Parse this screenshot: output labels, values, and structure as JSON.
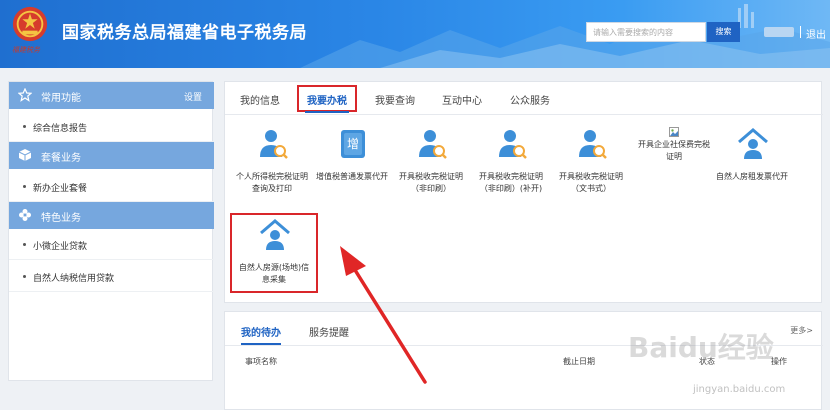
{
  "header": {
    "title": "国家税务总局福建省电子税务局",
    "emblem_script": "福建税务",
    "search_placeholder": "请输入需要搜索的内容",
    "search_button": "搜索",
    "logout": "退出"
  },
  "sidebar": {
    "sections": [
      {
        "title": "常用功能",
        "action": "设置",
        "icon": "star-icon",
        "items": [
          "综合信息报告"
        ]
      },
      {
        "title": "套餐业务",
        "icon": "cube-icon",
        "items": [
          "新办企业套餐"
        ]
      },
      {
        "title": "特色业务",
        "icon": "flower-icon",
        "items": [
          "小微企业贷款",
          "自然人纳税信用贷款"
        ]
      }
    ]
  },
  "main": {
    "tabs": [
      "我的信息",
      "我要办税",
      "我要查询",
      "互动中心",
      "公众服务"
    ],
    "active_tab": "我要办税",
    "services": [
      {
        "label": "个人所得税完税证明查询及打印",
        "icon": "person-search-icon"
      },
      {
        "label": "增值税普通发票代开",
        "icon": "invoice-icon",
        "glyph": "增"
      },
      {
        "label": "开具税收完税证明（非印刷）",
        "icon": "person-search-icon"
      },
      {
        "label": "开具税收完税证明（非印刷）(补开)",
        "icon": "person-search-icon"
      },
      {
        "label": "开具税收完税证明（文书式）",
        "icon": "person-search-icon"
      },
      {
        "label": "开具企业社保费完税证明",
        "icon": "broken-image-icon"
      },
      {
        "label": "自然人房租发票代开",
        "icon": "house-person-icon"
      },
      {
        "label": "自然人房源(场地)信息采集",
        "icon": "house-person-icon"
      }
    ]
  },
  "bottom": {
    "tabs": [
      "我的待办",
      "服务提醒"
    ],
    "more": "更多>",
    "columns": [
      "事项名称",
      "截止日期",
      "状态",
      "操作"
    ]
  },
  "watermark": {
    "main": "Baidu经验",
    "sub": "jingyan.baidu.com"
  },
  "colors": {
    "accent": "#1f63c3",
    "highlight": "#d9262a",
    "sidebar_head": "#76a7de"
  }
}
